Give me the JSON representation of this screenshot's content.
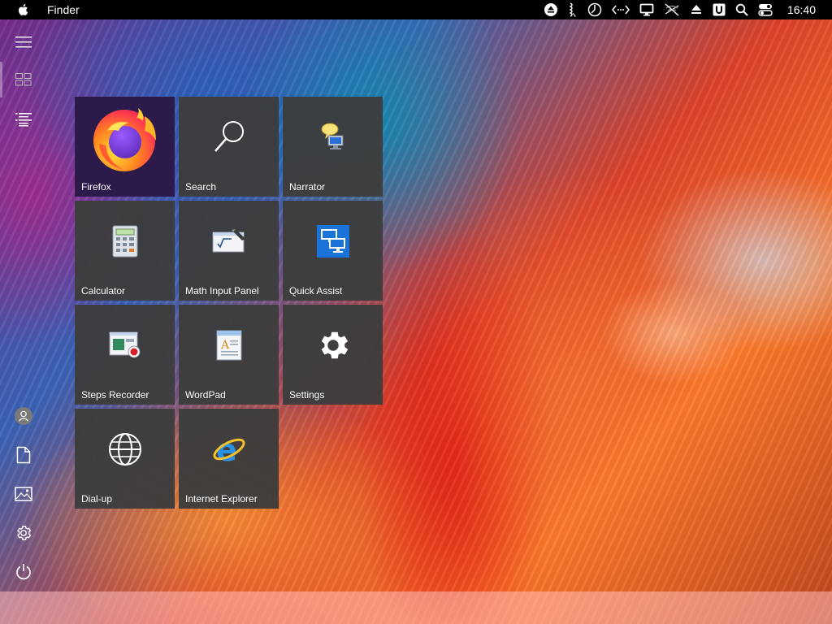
{
  "menubar": {
    "app_name": "Finder",
    "clock": "16:40",
    "tray_icons": [
      "eject-icon",
      "audio-icon",
      "clock-circle-icon",
      "code-arrows-icon",
      "display-icon",
      "network-off-icon",
      "upload-icon",
      "u-badge-icon",
      "search-icon",
      "toggle-icon"
    ]
  },
  "rail": {
    "top_icons": [
      "hamburger-icon",
      "tiles-view-icon",
      "list-view-icon"
    ],
    "bottom_icons": [
      "user-icon",
      "document-icon",
      "pictures-icon",
      "settings-icon",
      "power-icon"
    ]
  },
  "tiles": [
    {
      "label": "Firefox",
      "icon": "firefox-icon"
    },
    {
      "label": "Search",
      "icon": "magnifier-icon"
    },
    {
      "label": "Narrator",
      "icon": "narrator-icon"
    },
    {
      "label": "Calculator",
      "icon": "calculator-icon"
    },
    {
      "label": "Math Input Panel",
      "icon": "math-input-icon"
    },
    {
      "label": "Quick Assist",
      "icon": "quick-assist-icon"
    },
    {
      "label": "Steps Recorder",
      "icon": "steps-recorder-icon"
    },
    {
      "label": "WordPad",
      "icon": "wordpad-icon"
    },
    {
      "label": "Settings",
      "icon": "gear-icon"
    },
    {
      "label": "Dial-up",
      "icon": "globe-icon"
    },
    {
      "label": "Internet Explorer",
      "icon": "internet-explorer-icon"
    }
  ],
  "colors": {
    "tile_bg": "#3c3c3c",
    "firefox_tile_bg": "#2b1a4a",
    "menubar_bg": "#000000"
  }
}
